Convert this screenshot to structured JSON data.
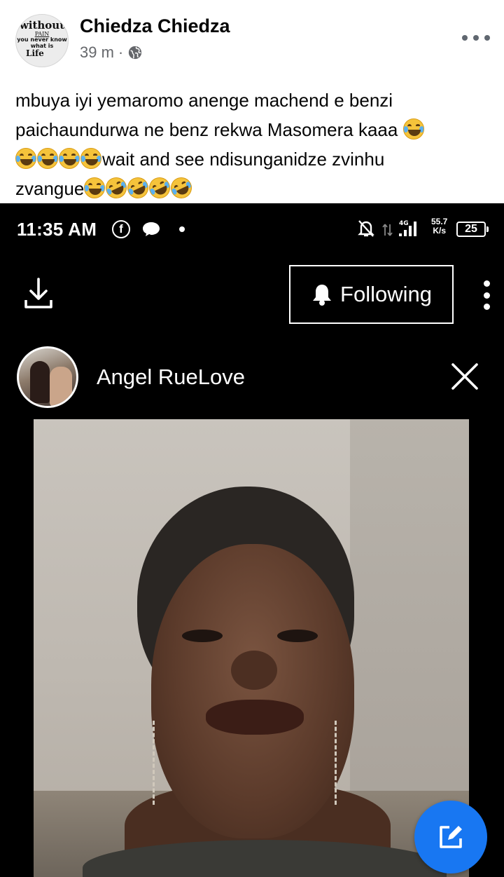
{
  "post": {
    "avatar_lines": [
      "without",
      "PAIN",
      "you never know",
      "what is",
      "Life"
    ],
    "author": "Chiedza Chiedza",
    "time": "39 m",
    "separator": "·",
    "privacy_icon": "globe-icon",
    "text_line1": "mbuya iyi yemaromo anenge machend e benzi",
    "text_line2": "paichaundurwa ne benz rekwa Masomera kaaa",
    "text_line3": "wait and see ndisunganidze zvinhu",
    "text_line4": "zvangue"
  },
  "status_bar": {
    "time": "11:35 AM",
    "network": "4G",
    "speed_value": "55.7",
    "speed_unit": "K/s",
    "battery": "25"
  },
  "story": {
    "following_label": "Following",
    "name": "Angel RueLove"
  },
  "colors": {
    "brand_blue": "#1877f2",
    "meta_gray": "#65676b"
  }
}
